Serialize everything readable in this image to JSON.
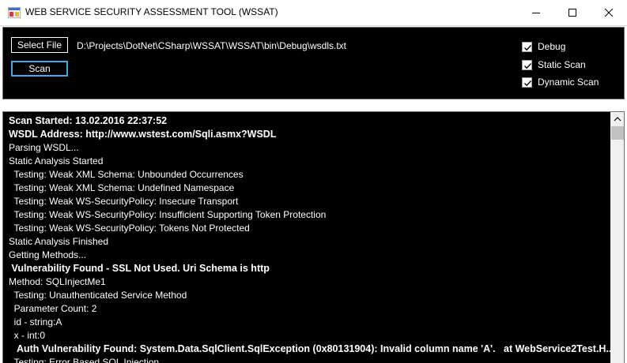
{
  "window": {
    "title": "WEB SERVICE SECURITY ASSESSMENT TOOL (WSSAT)",
    "icon": "app-icon"
  },
  "toolbar": {
    "select_file_label": "Select File",
    "scan_label": "Scan",
    "file_path": "D:\\Projects\\DotNet\\CSharp\\WSSAT\\WSSAT\\bin\\Debug\\wsdls.txt"
  },
  "options": [
    {
      "label": "Debug",
      "checked": true
    },
    {
      "label": "Static Scan",
      "checked": true
    },
    {
      "label": "Dynamic Scan",
      "checked": true
    }
  ],
  "log": [
    {
      "text": "Scan Started: 13.02.2016 22:37:52",
      "bold": true
    },
    {
      "text": "WSDL Address: http://www.wstest.com/Sqli.asmx?WSDL",
      "bold": true
    },
    {
      "text": "Parsing WSDL...",
      "bold": false
    },
    {
      "text": "Static Analysis Started",
      "bold": false
    },
    {
      "text": "  Testing: Weak XML Schema: Unbounded Occurrences",
      "bold": false
    },
    {
      "text": "  Testing: Weak XML Schema: Undefined Namespace",
      "bold": false
    },
    {
      "text": "  Testing: Weak WS-SecurityPolicy: Insecure Transport",
      "bold": false
    },
    {
      "text": "  Testing: Weak WS-SecurityPolicy: Insufficient Supporting Token Protection",
      "bold": false
    },
    {
      "text": "  Testing: Weak WS-SecurityPolicy: Tokens Not Protected",
      "bold": false
    },
    {
      "text": "Static Analysis Finished",
      "bold": false
    },
    {
      "text": "Getting Methods...",
      "bold": false
    },
    {
      "text": " Vulnerability Found - SSL Not Used. Uri Schema is http",
      "bold": true
    },
    {
      "text": "Method: SQLInjectMe1",
      "bold": false
    },
    {
      "text": "  Testing: Unauthenticated Service Method",
      "bold": false
    },
    {
      "text": "  Parameter Count: 2",
      "bold": false
    },
    {
      "text": "  id - string:A",
      "bold": false
    },
    {
      "text": "  x - int:0",
      "bold": false
    },
    {
      "text": "   Auth Vulnerability Found: System.Data.SqlClient.SqlException (0x80131904): Invalid column name 'A'.   at WebService2Test.H...",
      "bold": true
    },
    {
      "text": "  Testing: Error Based SQL Injection",
      "bold": false
    }
  ]
}
